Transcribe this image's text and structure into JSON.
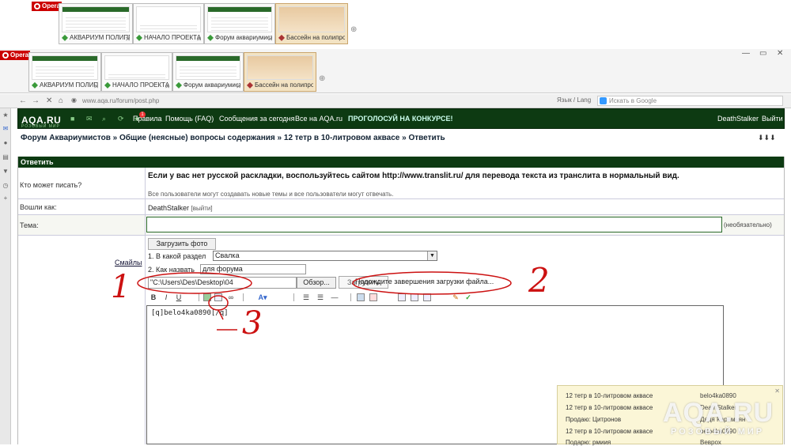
{
  "browser": {
    "opera_label": "Opera",
    "tabs_row1": [
      {
        "label": "АКВАРИУМ ПОЛИПР..."
      },
      {
        "label": "НАЧАЛО ПРОЕКТА (..."
      },
      {
        "label": "Форум аквариумист..."
      },
      {
        "label": "Бассейн на полипроп..."
      }
    ],
    "tabs_row2": [
      {
        "label": "АКВАРИУМ ПОЛИПР..."
      },
      {
        "label": "НАЧАЛО ПРОЕКТА (..."
      },
      {
        "label": "Форум аквариумист..."
      },
      {
        "label": "Бассейн на полипроп..."
      }
    ],
    "url": "www.aqa.ru/forum/post.php",
    "search_placeholder": "Искать в Google",
    "lang": "Язык / Lang"
  },
  "forum": {
    "logo": "AQA.RU",
    "logo_sub": "РОЗОВЫЙ МИР",
    "notif_count": "1",
    "nav": [
      "Правила",
      "Помощь (FAQ)",
      "Сообщения за сегодня",
      "Все на AQA.ru",
      "ПРОГОЛОСУЙ НА КОНКУРСЕ!"
    ],
    "username": "DeathStalker",
    "logout": "Выйти",
    "breadcrumb": "Форум Аквариумистов » Общие (неясные) вопросы содержания » 12 тетр в 10-литровом аквасе » Ответить",
    "arrows": "⬇⬇⬇"
  },
  "form": {
    "title": "Ответить",
    "who_label": "Кто может писать?",
    "note_bold": "Если у вас нет русской раскладки, воспользуйтесь сайтом http://www.translit.ru/ для перевода текста из транслита в нормальный вид.",
    "note_small": "Все пользователи могут создавать новые темы и все пользователи могут отвечать.",
    "logged_label": "Вошли как:",
    "logged_user": "DeathStalker",
    "logged_exit": "[выйти]",
    "topic_label": "Тема:",
    "topic_value": "",
    "topic_note": "(необязательно)",
    "smiles": "Смайлы",
    "upload_photo": "Загрузить фото",
    "section_label": "1. В какой раздел",
    "section_value": "Свалка",
    "name_label": "2. Как назвать",
    "name_value": "для форума",
    "file_value": "\"C:\\Users\\Des\\Desktop\\04",
    "browse": "Обзор...",
    "upload_btn": "Загрузить",
    "wait_msg": "Подождите завершения загрузки файла...",
    "editor_text": "[q]belo4ka0890[/q]"
  },
  "annotations": {
    "a1": "1",
    "a2": "2",
    "a3": "3"
  },
  "notifications": [
    {
      "title": "12 тетр в 10-литровом аквасе",
      "user": "belo4ka0890"
    },
    {
      "title": "12 тетр в 10-литровом аквасе",
      "user": "DeathStalker"
    },
    {
      "title": "Продаю: Цитронов",
      "user": "Дядя Карамьян"
    },
    {
      "title": "12 тетр в 10-литровом аквасе",
      "user": "belo4ka0890"
    },
    {
      "title": "Подарю: рмиия",
      "user": "Веврох"
    }
  ],
  "watermark": {
    "main": "AQA.RU",
    "sub": "РОЗОВЫЙ МИР"
  }
}
